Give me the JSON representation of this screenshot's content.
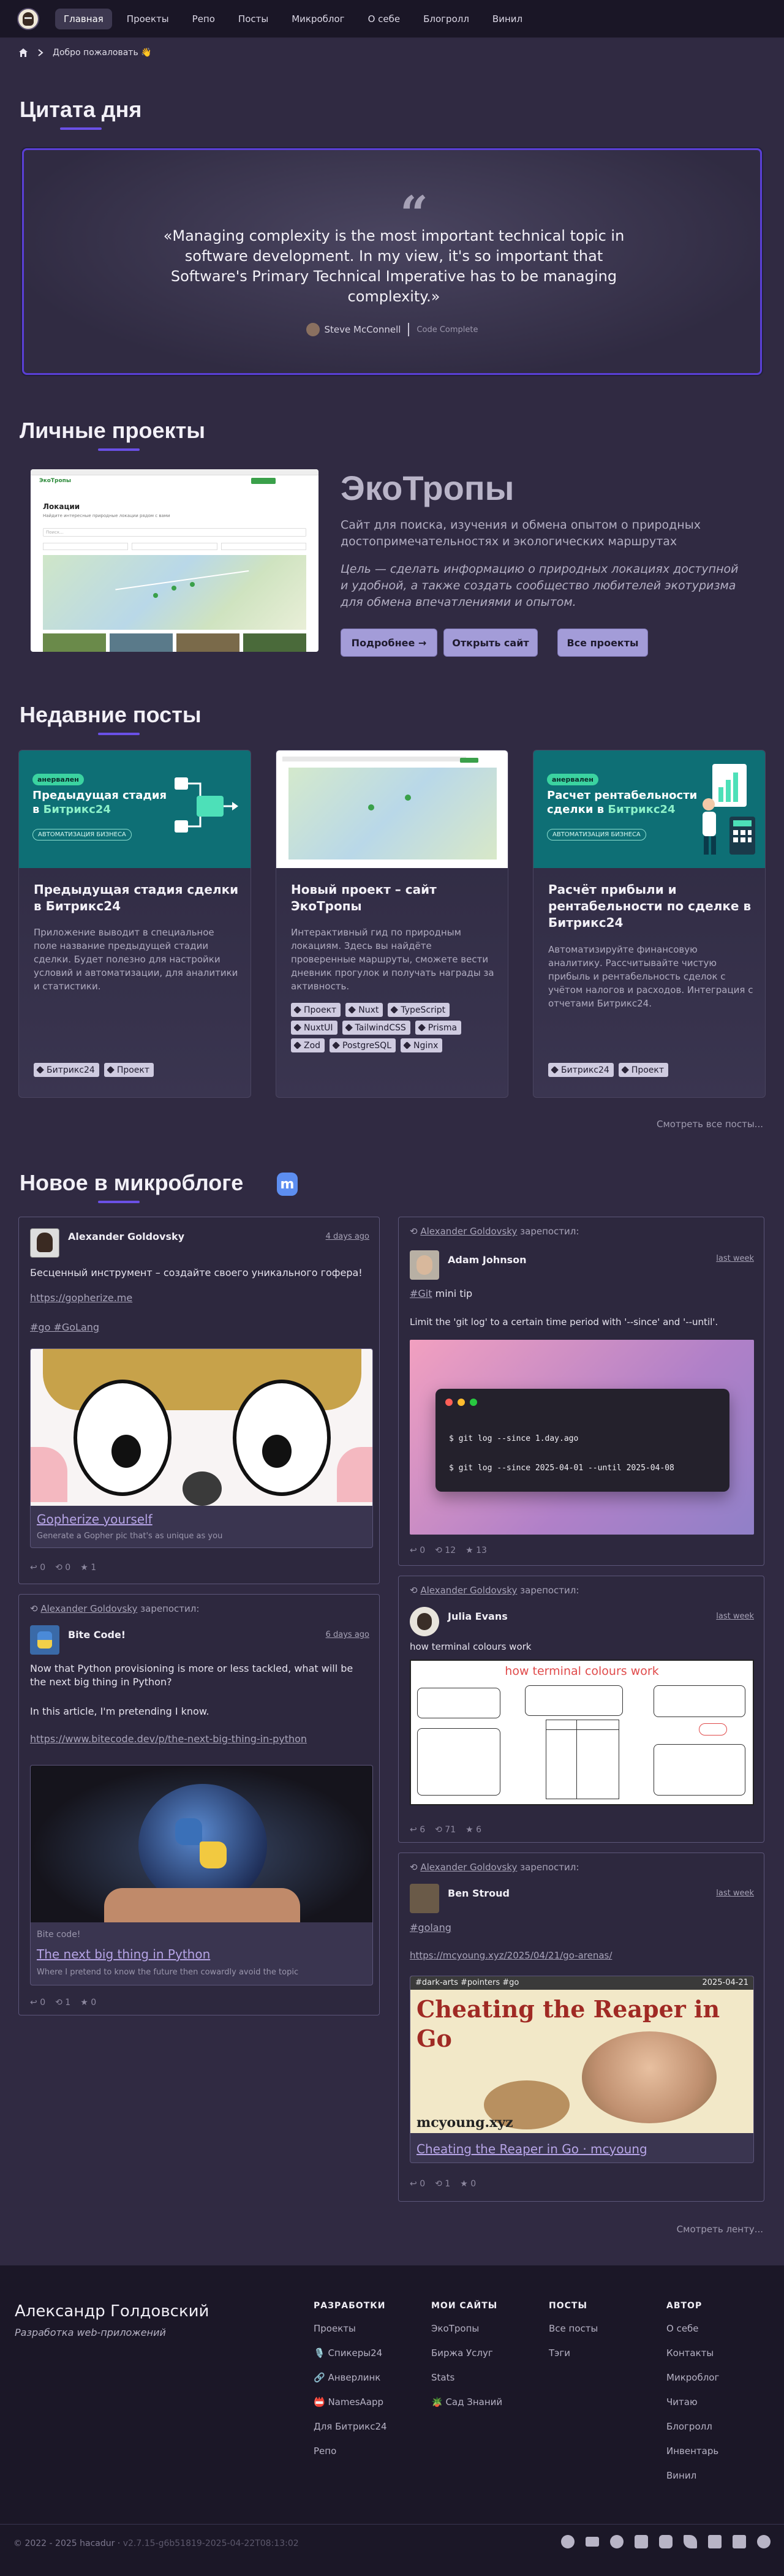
{
  "nav": {
    "items": [
      "Главная",
      "Проекты",
      "Репо",
      "Посты",
      "Микроблог",
      "О себе",
      "Блогролл",
      "Винил"
    ]
  },
  "breadcrumb": {
    "current": "Добро пожаловать 👋"
  },
  "quote_section": {
    "heading": "Цитата дня",
    "text": "«Managing complexity is the most important technical topic in software development. In my view, it's so important that Software's Primary Technical Imperative has to be managing complexity.»",
    "author": "Steve McConnell",
    "book": "Code Complete"
  },
  "projects": {
    "heading": "Личные проекты",
    "title": "ЭкоТропы",
    "description": "Сайт для поиска, изучения и обмена опытом о природных достопримечательностях и экологических маршрутах",
    "goal": "Цель — сделать информацию о природных локациях доступной и удобной, а также создать сообщество любителей экотуризма для обмена впечатлениями и опытом.",
    "btn_more": "Подробнее →",
    "btn_open": "Открыть сайт",
    "btn_all": "Все проекты",
    "screenshot": {
      "brand": "ЭкоТропы",
      "page_title": "Локации",
      "subtitle": "Найдите интересные природные локации рядом с вами",
      "search": "Поиск..."
    }
  },
  "posts": {
    "heading": "Недавние посты",
    "see_all": "Смотреть все посты...",
    "items": [
      {
        "badge": "анервален",
        "img_title_1": "Предыдущая стадия",
        "img_title_2": "в ",
        "img_title_accent": "Битрикс24",
        "img_pill": "АВТОМАТИЗАЦИЯ БИЗНЕСА",
        "title": "Предыдущая стадия сделки в Битрикс24",
        "text": "Приложение выводит в специальное поле название предыдущей стадии сделки. Будет полезно для настройки условий и автоматизации, для аналитики и статистики.",
        "tags": [
          "Битрикс24",
          "Проект"
        ]
      },
      {
        "title": "Новый проект – сайт ЭкоТропы",
        "text": "Интерактивный гид по природным локациям. Здесь вы найдёте проверенные маршруты, сможете вести дневник прогулок и получать награды за активность.",
        "tags": [
          "Проект",
          "Nuxt",
          "TypeScript",
          "NuxtUI",
          "TailwindCSS",
          "Prisma",
          "Zod",
          "PostgreSQL",
          "Nginx"
        ]
      },
      {
        "badge": "анервален",
        "img_title_1": "Расчет рентабельности",
        "img_title_2": "сделки в ",
        "img_title_accent": "Битрикс24",
        "img_pill": "АВТОМАТИЗАЦИЯ БИЗНЕСА",
        "title": "Расчёт прибыли и рентабельности по сделке в Битрикс24",
        "text": "Автоматизируйте финансовую аналитику. Рассчитывайте чистую прибыль и рентабельность сделок с учётом налогов и расходов. Интеграция с отчетами Битрикс24.",
        "tags": [
          "Битрикс24",
          "Проект"
        ]
      }
    ]
  },
  "microblog": {
    "heading": "Новое в микроблоге",
    "see_feed": "Смотреть ленту...",
    "repost_by": "Alexander Goldovsky",
    "repost_suffix": " зарепостил:",
    "left": [
      {
        "author": "Alexander Goldovsky",
        "date": "4 days ago",
        "text": "Бесценный инструмент – создайте своего уникального гофера!",
        "link": "https://gopherize.me",
        "hashtags": "#go #GoLang",
        "preview_title": "Gopherize yourself",
        "preview_sub": "Generate a Gopher pic that's as unique as you",
        "stats": [
          "0",
          "0",
          "1"
        ]
      },
      {
        "author": "Bite Code!",
        "date": "6 days ago",
        "text1": "Now that Python provisioning is more or less tackled, what will be the next big thing in Python?",
        "text2": "In this article, I'm pretending I know.",
        "link": "https://www.bitecode.dev/p/the-next-big-thing-in-python",
        "preview_site": "Bite code!",
        "preview_title": "The next big thing in Python",
        "preview_sub": "Where I pretend to know the future then cowardly avoid the topic",
        "stats": [
          "0",
          "1",
          "0"
        ]
      }
    ],
    "right": [
      {
        "author": "Adam Johnson",
        "date": "last week",
        "tag": "#Git",
        "tag_suffix": " mini tip",
        "text": "Limit the 'git log' to a certain time period with '--since' and '--until'.",
        "cmd1": "$ git log --since 1.day.ago",
        "cmd2": "$ git log --since 2025-04-01 --until 2025-04-08",
        "stats": [
          "0",
          "12",
          "13"
        ]
      },
      {
        "author": "Julia Evans",
        "date": "last week",
        "text": "how terminal colours work",
        "comic_title": "how terminal colours work",
        "stats": [
          "6",
          "71",
          "6"
        ]
      },
      {
        "author": "Ben Stroud",
        "date": "last week",
        "hashtag": "#golang",
        "link": "https://mcyoung.xyz/2025/04/21/go-arenas/",
        "img_tags": "#dark-arts #pointers #go",
        "img_date": "2025-04-21",
        "img_title": "Cheating the Reaper in Go",
        "img_site": "mcyoung.xyz",
        "preview_title": "Cheating the Reaper in Go · mcyoung",
        "stats": [
          "0",
          "1",
          "0"
        ]
      }
    ]
  },
  "footer": {
    "name": "Александр Голдовский",
    "subtitle": "Разработка web-приложений",
    "cols": [
      {
        "head": "РАЗРАБОТКИ",
        "links": [
          "Проекты",
          "🎙️ Спикеры24",
          "🔗 Анверлинк",
          "📛 NamesAapp",
          "Для Битрикс24",
          "Репо"
        ]
      },
      {
        "head": "МОИ САЙТЫ",
        "links": [
          "ЭкоТропы",
          "Биржа Услуг",
          "Stats",
          "🪴 Сад Знаний"
        ]
      },
      {
        "head": "ПОСТЫ",
        "links": [
          "Все посты",
          "Тэги"
        ]
      },
      {
        "head": "АВТОР",
        "links": [
          "О себе",
          "Контакты",
          "Микроблог",
          "Читаю",
          "Блогролл",
          "Инвентарь",
          "Винил"
        ]
      }
    ],
    "copyright": "© 2022 - 2025 hacadur",
    "version": "v2.7.15-g6b51819-2025-04-22T08:13:02"
  }
}
